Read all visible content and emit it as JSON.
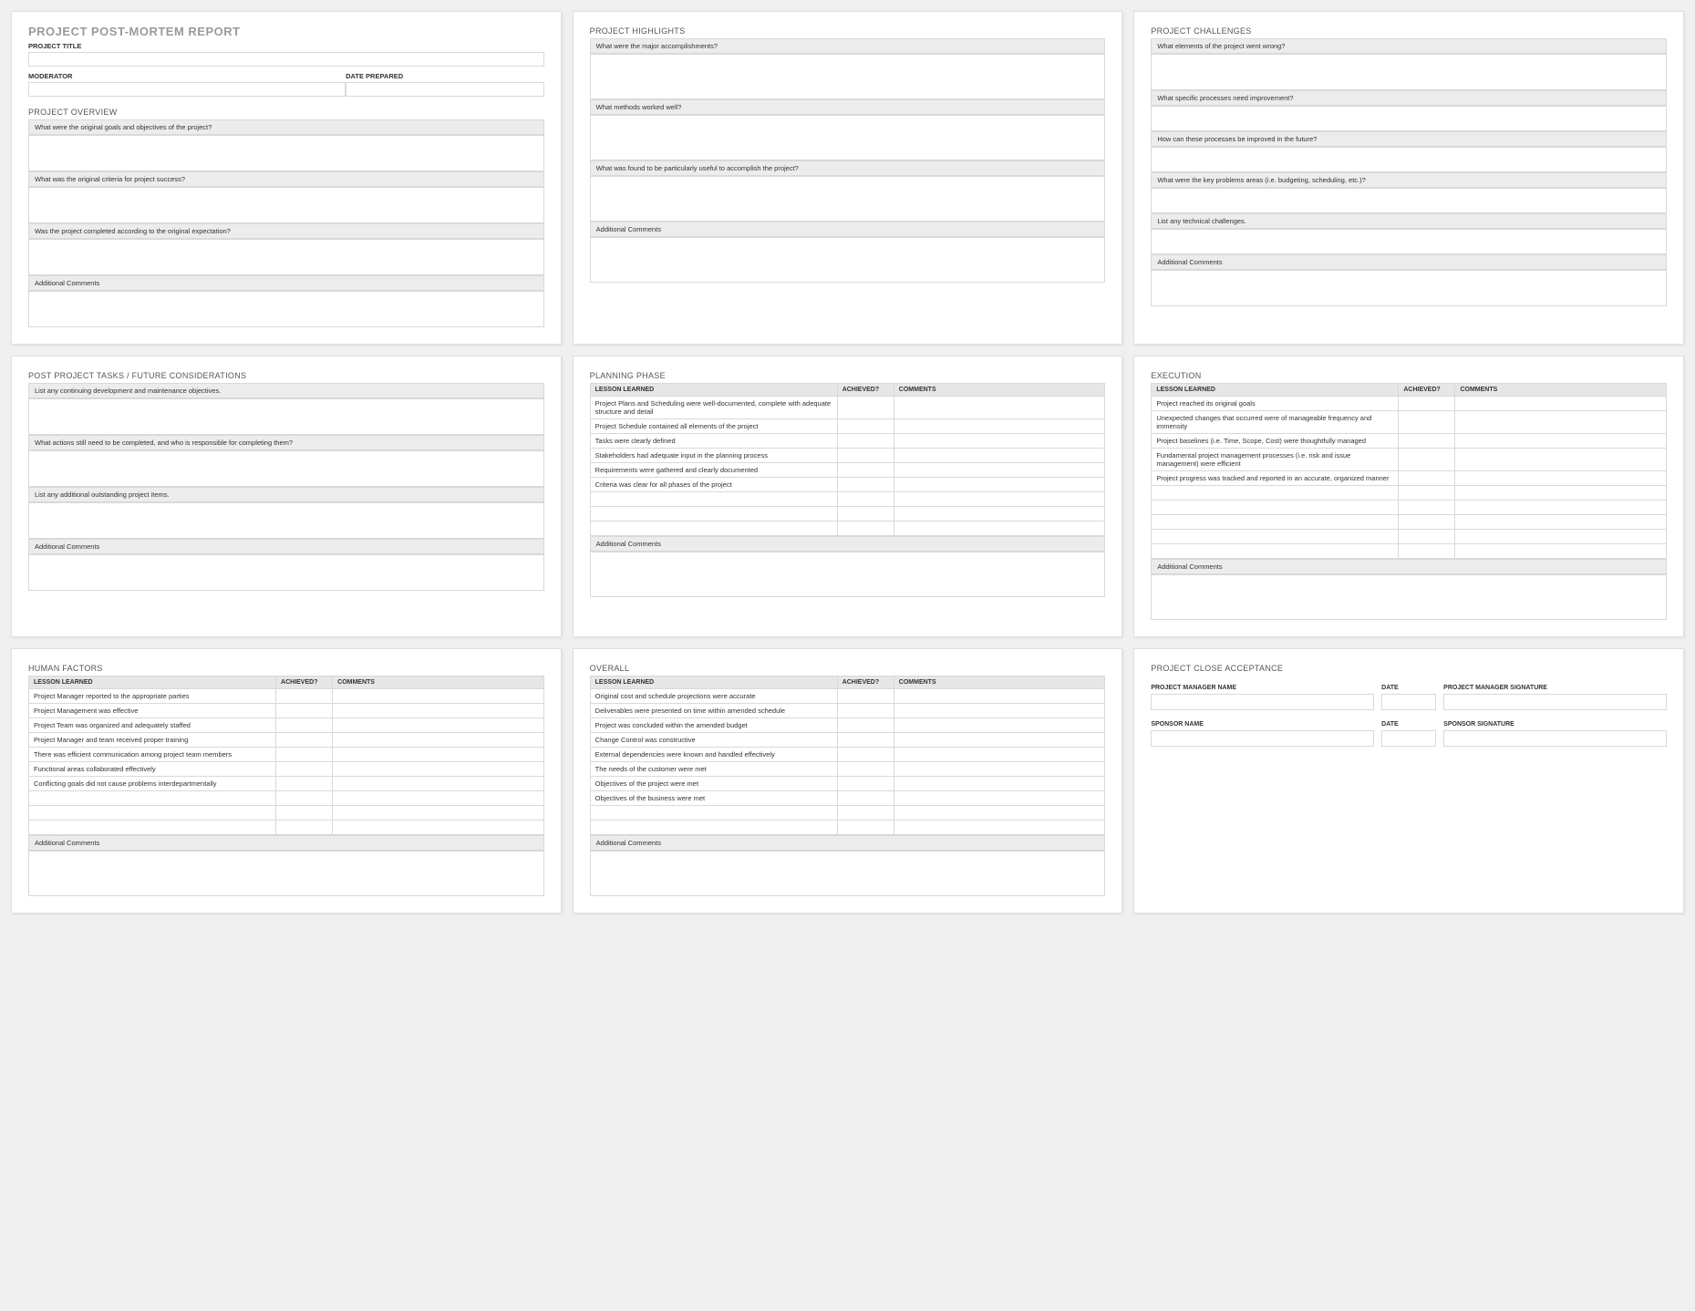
{
  "report": {
    "title": "PROJECT POST-MORTEM REPORT"
  },
  "labels": {
    "projectTitle": "PROJECT TITLE",
    "moderator": "MODERATOR",
    "datePrepared": "DATE PREPARED",
    "additionalComments": "Additional Comments"
  },
  "tableHeaders": {
    "lesson": "LESSON LEARNED",
    "achieved": "ACHIEVED?",
    "comments": "COMMENTS"
  },
  "panel1": {
    "overviewTitle": "PROJECT OVERVIEW",
    "q": [
      "What were the original goals and objectives of the project?",
      "What was the original criteria for project success?",
      "Was the project completed according to the original expectation?"
    ]
  },
  "panel2": {
    "title": "PROJECT HIGHLIGHTS",
    "q": [
      "What were the major accomplishments?",
      "What methods worked well?",
      "What was found to be particularly useful to accomplish the project?"
    ]
  },
  "panel3": {
    "title": "PROJECT CHALLENGES",
    "q": [
      "What elements of the project went wrong?",
      "What specific processes need improvement?",
      "How can these processes be improved in the future?",
      "What were the key problems areas (i.e. budgeting, scheduling, etc.)?",
      "List any technical challenges."
    ]
  },
  "panel4": {
    "title": "POST PROJECT TASKS / FUTURE CONSIDERATIONS",
    "q": [
      "List any continuing development and maintenance objectives.",
      "What actions still need to be completed, and who is responsible for completing them?",
      "List any additional outstanding project items."
    ]
  },
  "panel5": {
    "title": "PLANNING PHASE",
    "rows": [
      "Project Plans and Scheduling were well-documented, complete with adequate structure and detail",
      "Project Schedule contained all elements of the project",
      "Tasks were clearly defined",
      "Stakeholders had adequate input in the planning process",
      "Requirements were gathered and clearly documented",
      "Criteria was clear for all phases of the project",
      "",
      "",
      ""
    ]
  },
  "panel6": {
    "title": "EXECUTION",
    "rows": [
      "Project reached its original goals",
      "Unexpected changes that occurred were of manageable frequency and immensity",
      "Project baselines (i.e. Time, Scope, Cost) were thoughtfully managed",
      "Fundamental project management processes (i.e. risk and issue management) were efficient",
      "Project progress was tracked and reported in an accurate, organized manner",
      "",
      "",
      "",
      "",
      ""
    ]
  },
  "panel7": {
    "title": "HUMAN FACTORS",
    "rows": [
      "Project Manager reported to the appropriate parties",
      "Project Management was effective",
      "Project Team was organized and adequately staffed",
      "Project Manager and team received proper training",
      "There was efficient communication among project team members",
      "Functional areas collaborated effectively",
      "Conflicting goals did not cause problems interdepartmentally",
      "",
      "",
      ""
    ]
  },
  "panel8": {
    "title": "OVERALL",
    "rows": [
      "Original cost and schedule projections were accurate",
      "Deliverables were presented on time within amended schedule",
      "Project was concluded within the amended budget",
      "Change Control was constructive",
      "External dependencies were known and handled effectively",
      "The needs of the customer were met",
      "Objectives of the project were met",
      "Objectives of the business were met",
      "",
      ""
    ]
  },
  "panel9": {
    "title": "PROJECT CLOSE ACCEPTANCE",
    "row1": {
      "a": "PROJECT MANAGER NAME",
      "b": "DATE",
      "c": "PROJECT MANAGER SIGNATURE"
    },
    "row2": {
      "a": "SPONSOR NAME",
      "b": "DATE",
      "c": "SPONSOR SIGNATURE"
    }
  }
}
